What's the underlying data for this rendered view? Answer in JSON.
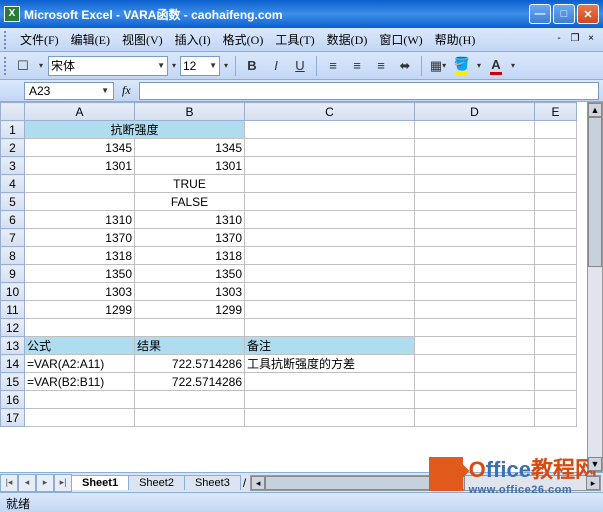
{
  "window": {
    "title": "Microsoft Excel - VARA函数 - caohaifeng.com"
  },
  "menu": {
    "file": "文件(F)",
    "edit": "编辑(E)",
    "view": "视图(V)",
    "insert": "插入(I)",
    "format": "格式(O)",
    "tools": "工具(T)",
    "data": "数据(D)",
    "window": "窗口(W)",
    "help": "帮助(H)"
  },
  "toolbar": {
    "font": "宋体",
    "size": "12"
  },
  "namebox": {
    "value": "A23"
  },
  "formula": {
    "value": ""
  },
  "columns": [
    "A",
    "B",
    "C",
    "D",
    "E"
  ],
  "rows": {
    "r1": {
      "A": "抗断强度"
    },
    "r2": {
      "A": "1345",
      "B": "1345"
    },
    "r3": {
      "A": "1301",
      "B": "1301"
    },
    "r4": {
      "B": "TRUE"
    },
    "r5": {
      "B": "FALSE"
    },
    "r6": {
      "A": "1310",
      "B": "1310"
    },
    "r7": {
      "A": "1370",
      "B": "1370"
    },
    "r8": {
      "A": "1318",
      "B": "1318"
    },
    "r9": {
      "A": "1350",
      "B": "1350"
    },
    "r10": {
      "A": "1303",
      "B": "1303"
    },
    "r11": {
      "A": "1299",
      "B": "1299"
    },
    "r13": {
      "A": "公式",
      "B": "结果",
      "C": "备注"
    },
    "r14": {
      "A": "=VAR(A2:A11)",
      "B": "722.5714286",
      "C": "工具抗断强度的方差"
    },
    "r15": {
      "A": "=VAR(B2:B11)",
      "B": "722.5714286"
    }
  },
  "sheets": {
    "s1": "Sheet1",
    "s2": "Sheet2",
    "s3": "Sheet3"
  },
  "status": {
    "ready": "就绪"
  },
  "watermark": {
    "brand1": "O",
    "brand2": "ffice",
    "brand3": "教程网",
    "url": "www.office26.com"
  }
}
